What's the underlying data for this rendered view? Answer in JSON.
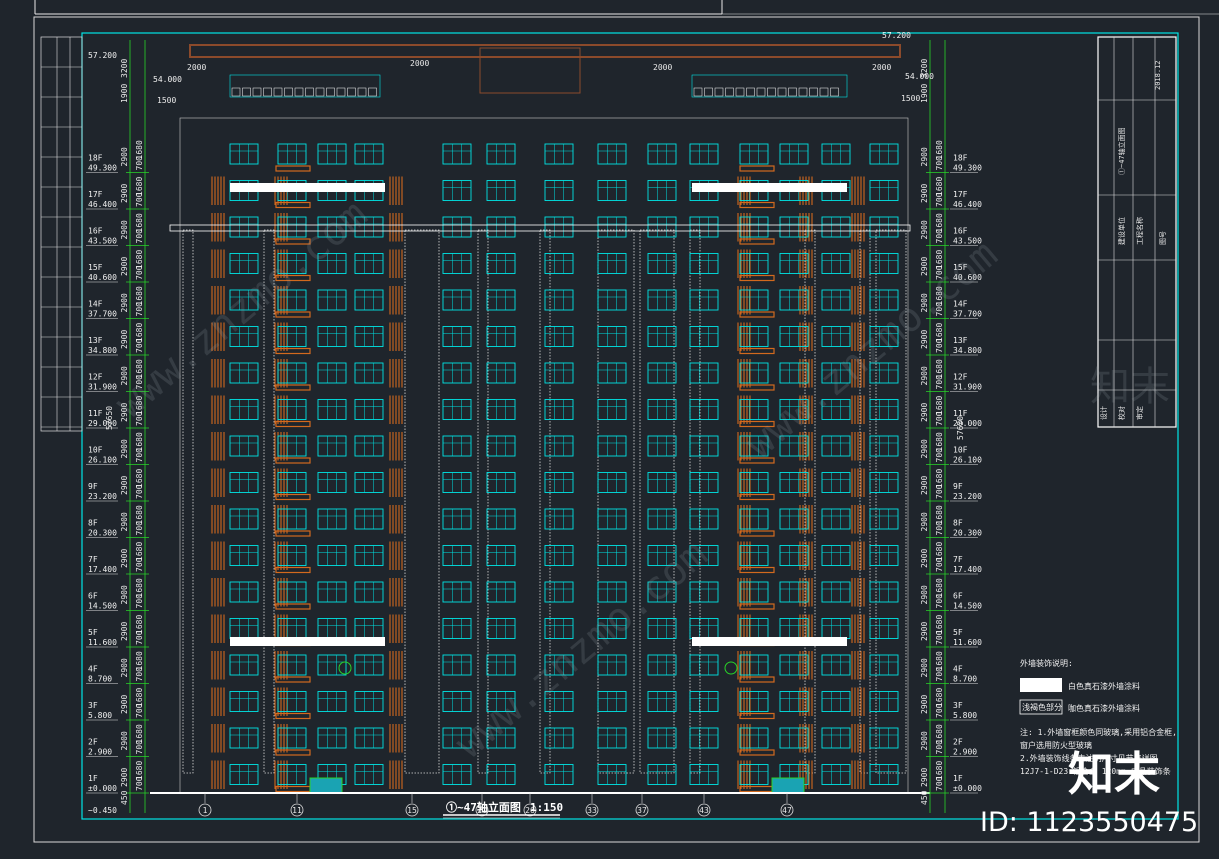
{
  "drawing": {
    "title": "①~47轴立面图",
    "scale": "1:150",
    "total_height": "57650",
    "top_elevation": "57.200",
    "parapet_elevation": "54.000",
    "pit_elevation": "−0.450"
  },
  "levels": [
    {
      "floor": "18F",
      "elev": "49.300"
    },
    {
      "floor": "17F",
      "elev": "46.400"
    },
    {
      "floor": "16F",
      "elev": "43.500"
    },
    {
      "floor": "15F",
      "elev": "40.600"
    },
    {
      "floor": "14F",
      "elev": "37.700"
    },
    {
      "floor": "13F",
      "elev": "34.800"
    },
    {
      "floor": "12F",
      "elev": "31.900"
    },
    {
      "floor": "11F",
      "elev": "29.000"
    },
    {
      "floor": "10F",
      "elev": "26.100"
    },
    {
      "floor": "9F",
      "elev": "23.200"
    },
    {
      "floor": "8F",
      "elev": "20.300"
    },
    {
      "floor": "7F",
      "elev": "17.400"
    },
    {
      "floor": "6F",
      "elev": "14.500"
    },
    {
      "floor": "5F",
      "elev": "11.600"
    },
    {
      "floor": "4F",
      "elev": "8.700"
    },
    {
      "floor": "3F",
      "elev": "5.800"
    },
    {
      "floor": "2F",
      "elev": "2.900"
    },
    {
      "floor": "1F",
      "elev": "±0.000"
    }
  ],
  "dims": {
    "floor": "2900",
    "sill": "520",
    "window": "1680",
    "head": "700",
    "roof": "3200",
    "roof2": "2200",
    "top": "1900",
    "ground": "450",
    "span_left": "2000",
    "span_right": "1500"
  },
  "legend": {
    "heading": "外墙装饰说明:",
    "item1": "白色真石漆外墙涂料",
    "item2_box": "浅褐色部分",
    "item2": "咖色真石漆外墙涂料"
  },
  "notes": {
    "n1": "注: 1.外墙窗框颜色同玻璃,采用铝合金框,",
    "n1b": "    窗户选用防火型玻璃",
    "n2": "2.外墙装饰线条未注明尺寸见节点详图",
    "n3": "12J7-1-D23 铝合金 120mm 成品装饰条"
  },
  "axes": [
    "1",
    "11",
    "15",
    "21",
    "26",
    "33",
    "37",
    "43",
    "47"
  ],
  "title_block": {
    "date": "2018.12",
    "scale_lbl": "比例",
    "design": "设计",
    "check": "校对",
    "approve": "审定",
    "sheet_name": "①~47轴立面图",
    "project": "建设单位",
    "proj2": "工程名称",
    "drawing_no": "图号"
  },
  "watermark": {
    "brand": "知末",
    "id": "ID: 1123550475",
    "site": "www.znzmo.com"
  },
  "colors": {
    "bg": "#1f252c",
    "frame": "#00e5e5",
    "wall_white": "#ffffff",
    "accent_brown": "#d2691e",
    "green": "#29d329"
  }
}
